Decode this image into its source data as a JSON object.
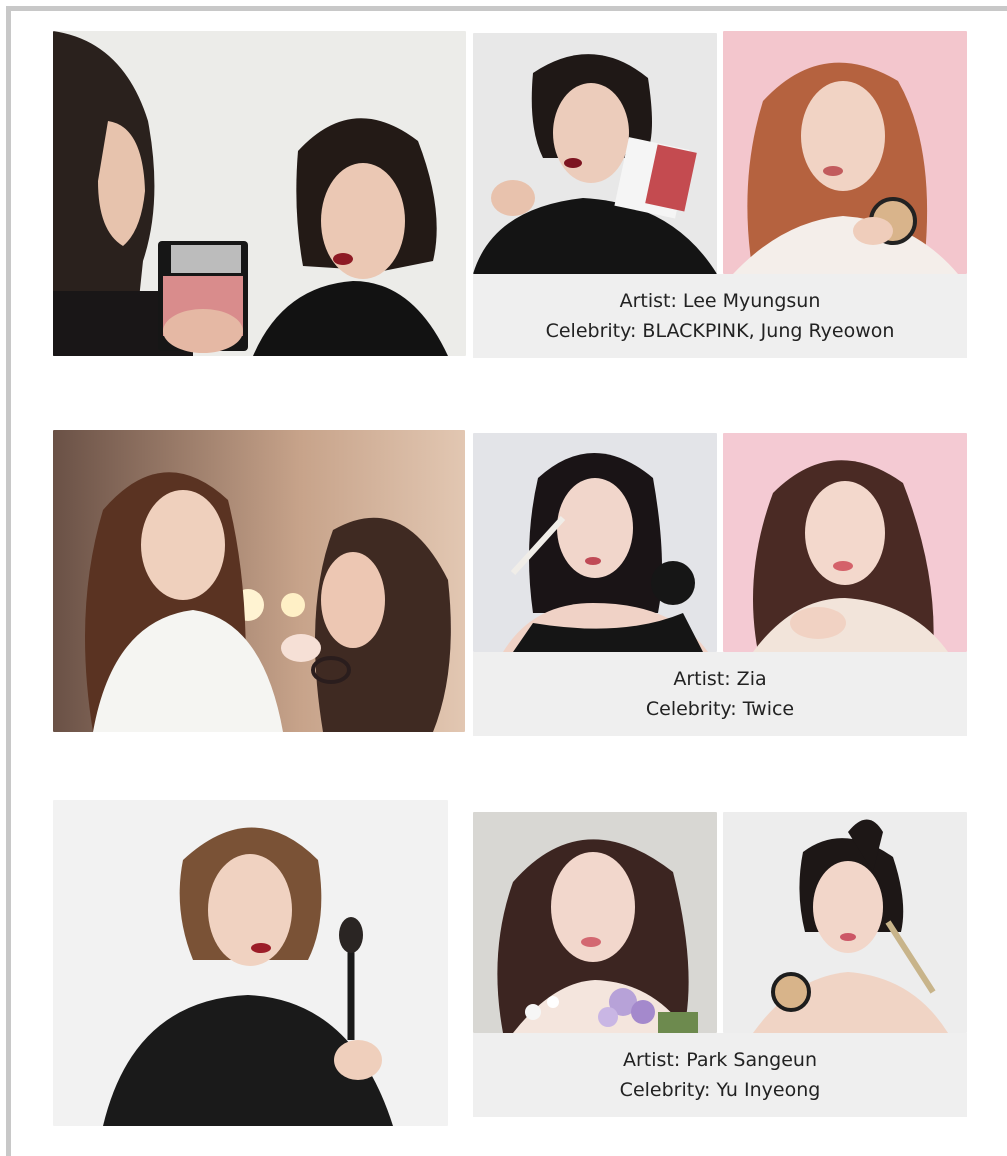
{
  "groups": [
    {
      "artist_line": "Artist: Lee Myungsun",
      "celebrity_line": "Celebrity: BLACKPINK, Jung Ryeowon",
      "photos": [
        {
          "alt": "artist applying lipstick",
          "bg": "#ececea"
        },
        {
          "alt": "model with palette",
          "bg": "#e9e9e9"
        },
        {
          "alt": "model pink background",
          "bg": "#f2c4cc"
        }
      ]
    },
    {
      "artist_line": "Artist: Zia",
      "celebrity_line": "Celebrity: Twice",
      "photos": [
        {
          "alt": "artist applying makeup backstage",
          "bg": "#b98f72"
        },
        {
          "alt": "model with brush",
          "bg": "#e3e4e8"
        },
        {
          "alt": "model pink background",
          "bg": "#f4c9d3"
        }
      ]
    },
    {
      "artist_line": "Artist: Park Sangeun",
      "celebrity_line": "Celebrity: Yu Inyeong",
      "photos": [
        {
          "alt": "artist holding brush",
          "bg": "#f1f1f1"
        },
        {
          "alt": "model with flowers",
          "bg": "#d9d9d6"
        },
        {
          "alt": "model with cushion",
          "bg": "#ececec"
        }
      ]
    }
  ]
}
